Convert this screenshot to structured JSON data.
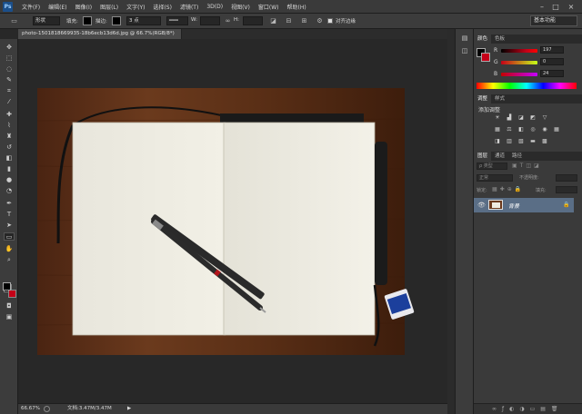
{
  "app": {
    "logo": "Ps"
  },
  "menu": [
    "文件(F)",
    "编辑(E)",
    "图像(I)",
    "图层(L)",
    "文字(Y)",
    "选择(S)",
    "滤镜(T)",
    "3D(D)",
    "视图(V)",
    "窗口(W)",
    "帮助(H)"
  ],
  "window_controls": {
    "minimize": "–",
    "maximize": "□",
    "close": "×"
  },
  "options": {
    "shape_mode": "形状",
    "fill_label": "填充:",
    "stroke_label": "描边:",
    "stroke_width": "3 点",
    "w_label": "W:",
    "h_label": "H:",
    "align_edges_label": "对齐边缘",
    "workspace": "基本功能"
  },
  "document": {
    "tab_title": "photo-1501818669935-18b6ecb13d6d.jpg @ 66.7%(RGB/8*)",
    "tab_close": "×",
    "zoom": "66.67%",
    "doc_info": "文档:3.47M/3.47M"
  },
  "color_panel": {
    "tabs": [
      "颜色",
      "色板"
    ],
    "r_label": "R",
    "g_label": "G",
    "b_label": "B",
    "r": 197,
    "g": 0,
    "b": 24
  },
  "adjustments_panel": {
    "tabs": [
      "调整",
      "样式"
    ],
    "title": "添加调整"
  },
  "layers_panel": {
    "tabs": [
      "图层",
      "通道",
      "路径"
    ],
    "kind_label": "ρ 类型",
    "blend_mode": "正常",
    "opacity_label": "不透明度:",
    "lock_label": "锁定:",
    "fill_label": "填充:",
    "layer_name": "背景"
  },
  "colors": {
    "foreground": "#000000",
    "background": "#c50018",
    "ui_accent": "#1b4f8a"
  }
}
